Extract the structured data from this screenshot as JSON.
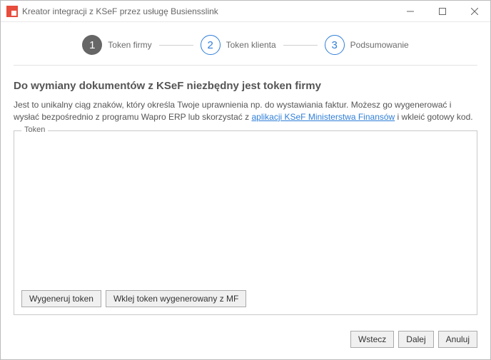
{
  "titlebar": {
    "title": "Kreator integracji z KSeF przez usługę Busiensslink"
  },
  "stepper": {
    "step1": {
      "num": "1",
      "label": "Token firmy"
    },
    "step2": {
      "num": "2",
      "label": "Token klienta"
    },
    "step3": {
      "num": "3",
      "label": "Podsumowanie"
    }
  },
  "main": {
    "heading": "Do wymiany dokumentów z KSeF niezbędny jest token firmy",
    "desc_part1": "Jest to unikalny ciąg znaków, który określa Twoje uprawnienia np. do wystawiania faktur. Możesz go wygenerować i wysłać bezpośrednio z programu Wapro ERP lub skorzystać z ",
    "desc_link": "aplikacji KSeF Ministerstwa Finansów",
    "desc_part2": " i wkleić gotowy kod."
  },
  "token_group": {
    "legend": "Token",
    "generate_label": "Wygeneruj token",
    "paste_label": "Wklej token wygenerowany z MF"
  },
  "footer": {
    "back_label": "Wstecz",
    "next_label": "Dalej",
    "cancel_label": "Anuluj"
  }
}
